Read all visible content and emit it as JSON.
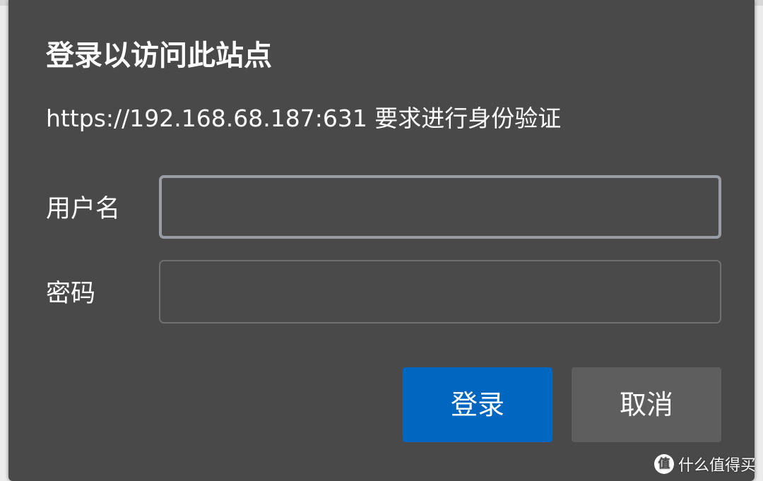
{
  "dialog": {
    "title": "登录以访问此站点",
    "subtitle": "https://192.168.68.187:631 要求进行身份验证",
    "username_label": "用户名",
    "username_value": "",
    "password_label": "密码",
    "password_value": "",
    "login_label": "登录",
    "cancel_label": "取消"
  },
  "watermark": {
    "logo_glyph": "值",
    "text": "什么值得买"
  },
  "colors": {
    "dialog_bg": "#494949",
    "primary_button": "#0067c0",
    "secondary_button": "#5e5e5e",
    "focused_border": "#9a9ea4"
  }
}
